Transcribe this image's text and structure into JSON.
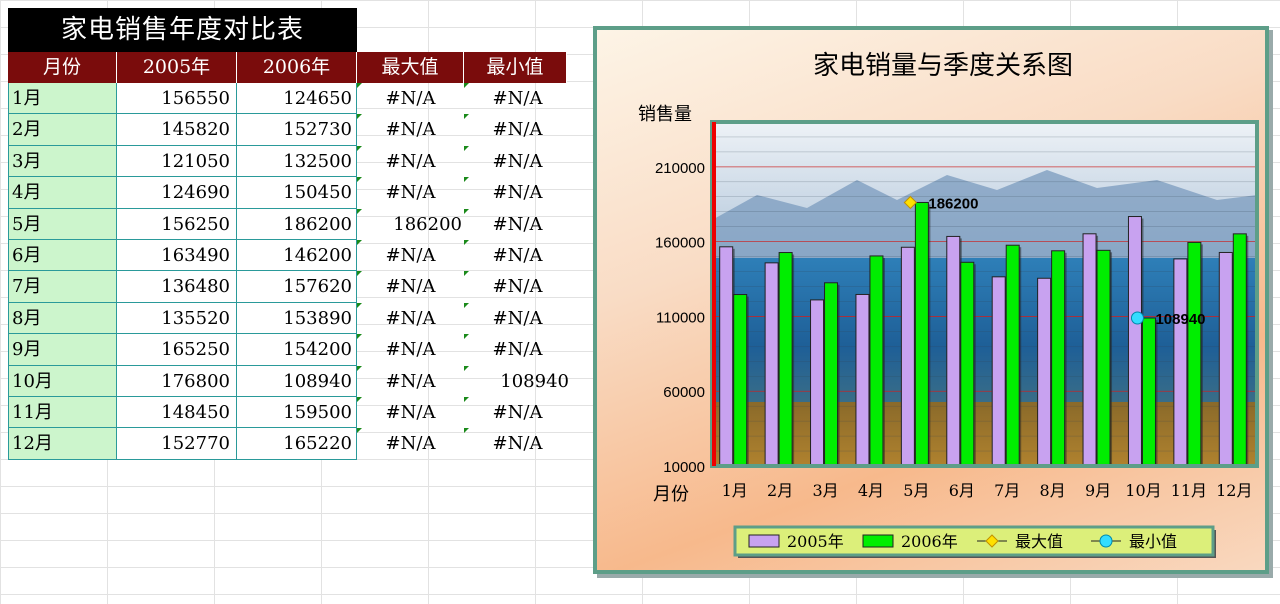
{
  "sheet": {
    "title": "家电销售年度对比表",
    "headers": [
      "月份",
      "2005年",
      "2006年",
      "最大值",
      "最小值"
    ],
    "rows": [
      {
        "month": "1月",
        "y2005": "156550",
        "y2006": "124650",
        "max": "#N/A",
        "min": "#N/A"
      },
      {
        "month": "2月",
        "y2005": "145820",
        "y2006": "152730",
        "max": "#N/A",
        "min": "#N/A"
      },
      {
        "month": "3月",
        "y2005": "121050",
        "y2006": "132500",
        "max": "#N/A",
        "min": "#N/A"
      },
      {
        "month": "4月",
        "y2005": "124690",
        "y2006": "150450",
        "max": "#N/A",
        "min": "#N/A"
      },
      {
        "month": "5月",
        "y2005": "156250",
        "y2006": "186200",
        "max": "186200",
        "min": "#N/A"
      },
      {
        "month": "6月",
        "y2005": "163490",
        "y2006": "146200",
        "max": "#N/A",
        "min": "#N/A"
      },
      {
        "month": "7月",
        "y2005": "136480",
        "y2006": "157620",
        "max": "#N/A",
        "min": "#N/A"
      },
      {
        "month": "8月",
        "y2005": "135520",
        "y2006": "153890",
        "max": "#N/A",
        "min": "#N/A"
      },
      {
        "month": "9月",
        "y2005": "165250",
        "y2006": "154200",
        "max": "#N/A",
        "min": "#N/A"
      },
      {
        "month": "10月",
        "y2005": "176800",
        "y2006": "108940",
        "max": "#N/A",
        "min": "108940"
      },
      {
        "month": "11月",
        "y2005": "148450",
        "y2006": "159500",
        "max": "#N/A",
        "min": "#N/A"
      },
      {
        "month": "12月",
        "y2005": "152770",
        "y2006": "165220",
        "max": "#N/A",
        "min": "#N/A"
      }
    ]
  },
  "chart_data": {
    "type": "bar",
    "title": "家电销量与季度关系图",
    "xlabel": "月份",
    "ylabel": "销售量",
    "categories": [
      "1月",
      "2月",
      "3月",
      "4月",
      "5月",
      "6月",
      "7月",
      "8月",
      "9月",
      "10月",
      "11月",
      "12月"
    ],
    "series": [
      {
        "name": "2005年",
        "type": "bar",
        "color": "#c8a2f0",
        "values": [
          156550,
          145820,
          121050,
          124690,
          156250,
          163490,
          136480,
          135520,
          165250,
          176800,
          148450,
          152770
        ]
      },
      {
        "name": "2006年",
        "type": "bar",
        "color": "#00ee00",
        "values": [
          124650,
          152730,
          132500,
          150450,
          186200,
          146200,
          157620,
          153890,
          154200,
          108940,
          159500,
          165220
        ]
      },
      {
        "name": "最大值",
        "type": "marker",
        "marker": "diamond",
        "color": "#ffe000",
        "values": [
          null,
          null,
          null,
          null,
          186200,
          null,
          null,
          null,
          null,
          null,
          null,
          null
        ]
      },
      {
        "name": "最小值",
        "type": "marker",
        "marker": "circle",
        "color": "#33ddff",
        "values": [
          null,
          null,
          null,
          null,
          null,
          null,
          null,
          null,
          null,
          108940,
          null,
          null
        ]
      }
    ],
    "data_labels": [
      {
        "category": "5月",
        "value": 186200,
        "text": "186200"
      },
      {
        "category": "10月",
        "value": 108940,
        "text": "108940"
      }
    ],
    "yticks": [
      "10000",
      "60000",
      "110000",
      "160000",
      "210000"
    ],
    "ylim": [
      10000,
      240000
    ],
    "grid": true,
    "legend_position": "bottom",
    "axis_color": "#ee0000"
  }
}
